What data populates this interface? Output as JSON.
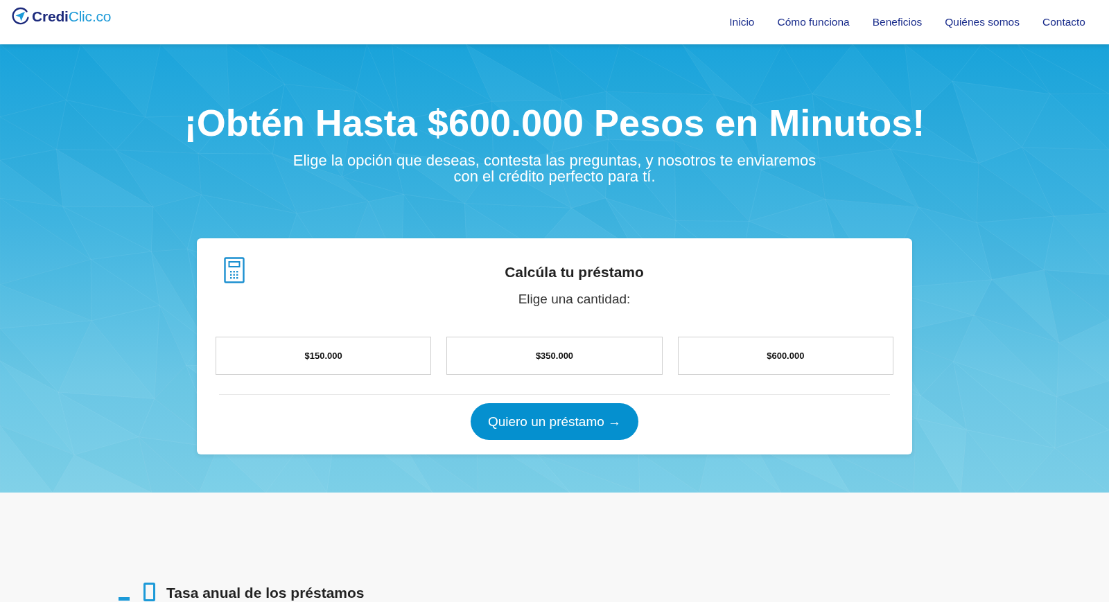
{
  "header": {
    "logo": {
      "brand": "Credi",
      "suffix": "Clic.co"
    },
    "nav": [
      "Inicio",
      "Cómo funciona",
      "Beneficios",
      "Quiénes somos",
      "Contacto"
    ]
  },
  "hero": {
    "title": "¡Obtén Hasta $600.000 Pesos en Minutos!",
    "subtitle": "Elige la opción que deseas, contesta las preguntas, y nosotros te enviaremos con el crédito perfecto para tí."
  },
  "calculator": {
    "title": "Calcúla tu préstamo",
    "prompt": "Elige una cantidad:",
    "amounts": [
      {
        "label": "$150.000",
        "selected": false
      },
      {
        "label": "$350.000",
        "selected": false
      },
      {
        "label": "$600.000",
        "selected": false
      }
    ],
    "submit": "Quiero un préstamo →"
  },
  "rates_section": {
    "heading": "Tasa anual de los préstamos"
  }
}
